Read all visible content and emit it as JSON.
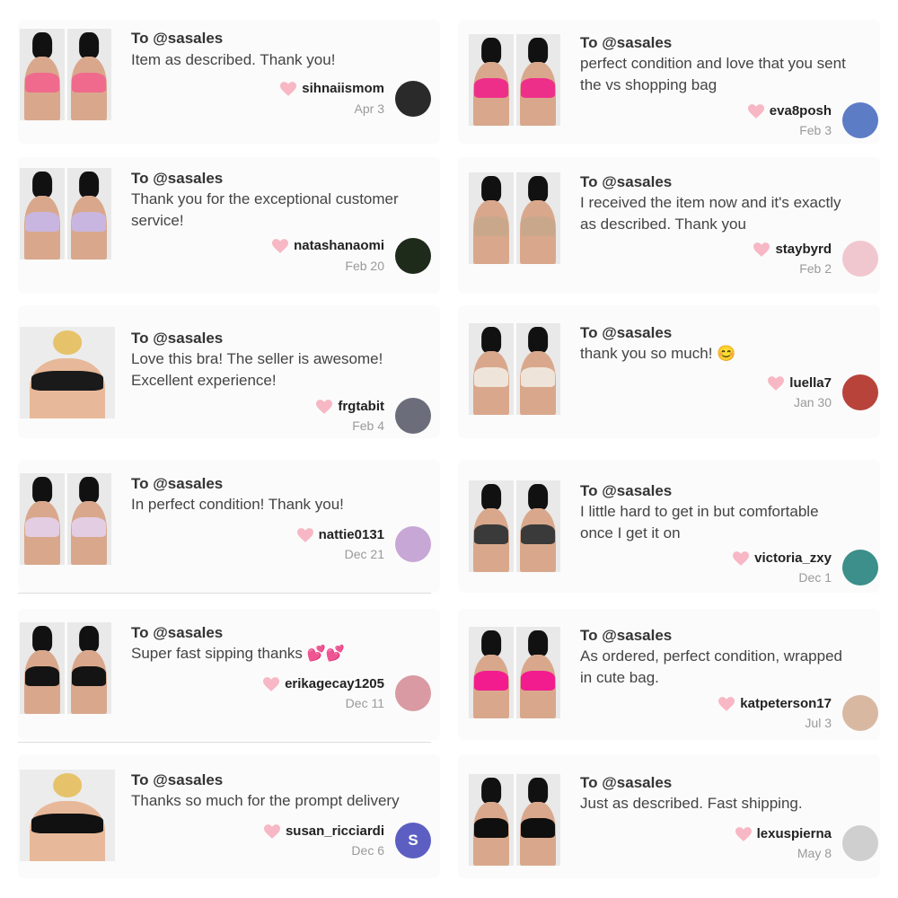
{
  "heart_color": "#f7b7c4",
  "cards": [
    {
      "to": "To @sasales",
      "message": "Item as described. Thank you!",
      "user": "sihnaiismom",
      "date": "Apr 3",
      "avatar_color": "#2a2a2a",
      "bra_color": "#f06a8d"
    },
    {
      "to": "To @sasales",
      "message": "perfect condition and love that you sent\nthe vs shopping bag",
      "user": "eva8posh",
      "date": "Feb 3",
      "avatar_color": "#5d7cc6",
      "bra_color": "#ee2f8a"
    },
    {
      "to": "To @sasales",
      "message": "Thank you for the exceptional customer\nservice!",
      "user": "natashanaomi",
      "date": "Feb 20",
      "avatar_color": "#1e2a1a",
      "bra_color": "#c9b6e0"
    },
    {
      "to": "To @sasales",
      "message": "I received the item now and it's exactly\nas described. Thank you",
      "user": "staybyrd",
      "date": "Feb 2",
      "avatar_color": "#f1c7cf",
      "bra_color": "#c9a78b"
    },
    {
      "to": "To @sasales",
      "message": "Love this bra! The seller is awesome!\nExcellent experience!",
      "user": "frgtabit",
      "date": "Feb 4",
      "avatar_color": "#6b6d7a",
      "bra_color": "#1a1a1a"
    },
    {
      "to": "To @sasales",
      "message": "thank you so much! 😊",
      "user": "luella7",
      "date": "Jan 30",
      "avatar_color": "#b8433a",
      "bra_color": "#efe4da"
    },
    {
      "to": "To @sasales",
      "message": "In perfect condition! Thank you!",
      "user": "nattie0131",
      "date": "Dec 21",
      "avatar_color": "#c7a7d6",
      "bra_color": "#e3cde3"
    },
    {
      "to": "To @sasales",
      "message": "I little hard to get in but comfortable\nonce I get it on",
      "user": "victoria_zxy",
      "date": "Dec 1",
      "avatar_color": "#3c8f8a",
      "bra_color": "#3a3a3a"
    },
    {
      "to": "To @sasales",
      "message": "Super fast sipping thanks 💕💕",
      "user": "erikagecay1205",
      "date": "Dec 11",
      "avatar_color": "#d99aa3",
      "bra_color": "#141414"
    },
    {
      "to": "To @sasales",
      "message": "As ordered, perfect condition, wrapped\nin cute bag.",
      "user": "katpeterson17",
      "date": "Jul 3",
      "avatar_color": "#d9b8a2",
      "bra_color": "#f21c8f"
    },
    {
      "to": "To @sasales",
      "message": "Thanks so much for the prompt delivery",
      "user": "susan_ricciardi",
      "date": "Dec 6",
      "avatar_color": "#5c5fc1",
      "avatar_letter": "S",
      "bra_color": "#111111"
    },
    {
      "to": "To @sasales",
      "message": "Just as described. Fast shipping.",
      "user": "lexuspierna",
      "date": "May 8",
      "avatar_color": "#cfcfcf",
      "bra_color": "#0f0f0f"
    }
  ]
}
